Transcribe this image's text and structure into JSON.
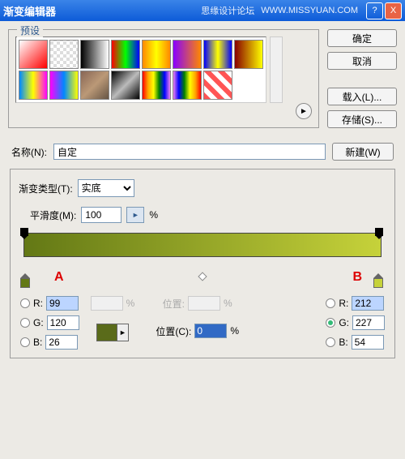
{
  "titlebar": {
    "title": "渐变编辑器",
    "watermark1": "思缘设计论坛",
    "watermark2": "WWW.MISSYUAN.COM"
  },
  "winbtns": {
    "help": "?",
    "close": "X"
  },
  "preset": {
    "label": "预设",
    "arrow": "►"
  },
  "sidebtns": {
    "ok": "确定",
    "cancel": "取消",
    "load": "载入(L)...",
    "save": "存储(S)..."
  },
  "swatches": [
    "linear-gradient(135deg,#fff,#f00)",
    "repeating-conic-gradient(#ddd 0 25%,#fff 0 50%) 0/8px 8px",
    "linear-gradient(90deg,#000,#fff)",
    "linear-gradient(90deg,#f00,#0f0,#00f)",
    "linear-gradient(90deg,#f80,#ff0,#f80)",
    "linear-gradient(90deg,#80f,#f80)",
    "linear-gradient(90deg,#00f,#ff0,#00f)",
    "linear-gradient(90deg,#800,#ff0)",
    "linear-gradient(90deg,#08f,#ff0,#f0f)",
    "linear-gradient(90deg,#f0f,#08f,#ff0)",
    "linear-gradient(135deg,#865,#b97,#654)",
    "linear-gradient(135deg,#000,#bbb,#000)",
    "linear-gradient(90deg,red,orange,yellow,green,blue,violet)",
    "linear-gradient(90deg,violet,blue,green,yellow,orange,red)",
    "repeating-linear-gradient(45deg,#f55 0 6px,#fff 6px 12px)"
  ],
  "name": {
    "label": "名称(N):",
    "value": "自定",
    "newbtn": "新建(W)"
  },
  "grad": {
    "typelabel": "渐变类型(T):",
    "typeval": "实底",
    "smoothlabel": "平滑度(M):",
    "smoothval": "100",
    "pct": "%",
    "arrow": "►"
  },
  "ann": {
    "a": "A",
    "b": "B"
  },
  "left": {
    "r_label": "R:",
    "r": "99",
    "g_label": "G:",
    "g": "120",
    "b_label": "B:",
    "b": "26"
  },
  "right": {
    "r_label": "R:",
    "r": "212",
    "g_label": "G:",
    "g": "227",
    "b_label": "B:",
    "b": "54"
  },
  "mid": {
    "pct": "%",
    "poslabel": "位置:",
    "poslabel2": "位置(C):",
    "posval": "0",
    "swatch_arrow": "►"
  }
}
